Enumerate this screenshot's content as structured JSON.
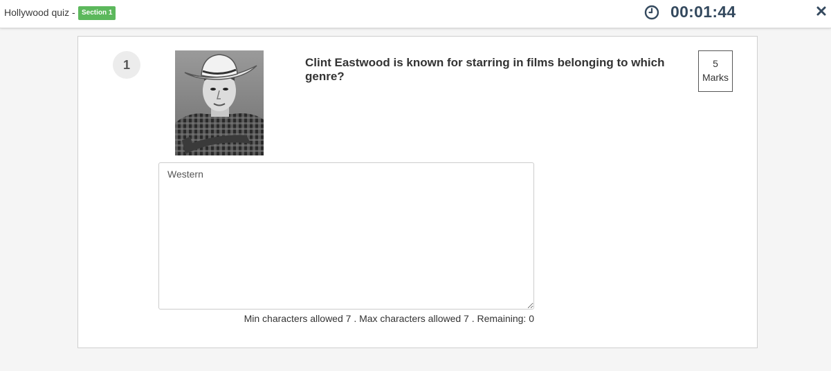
{
  "header": {
    "quiz_title": "Hollywood quiz -",
    "section_badge": "Section 1",
    "timer": "00:01:44",
    "icons": {
      "clock": "clock-icon",
      "close": "close-icon"
    },
    "colors": {
      "badge": "#5cb85c",
      "timer": "#34495e"
    }
  },
  "question": {
    "number": "1",
    "text": "Clint Eastwood is known for starring in films belonging to which genre?",
    "marks_value": "5",
    "marks_label": "Marks"
  },
  "answer": {
    "value": "Western",
    "char_info": "Min characters allowed 7 . Max characters allowed 7 . Remaining: 0"
  }
}
